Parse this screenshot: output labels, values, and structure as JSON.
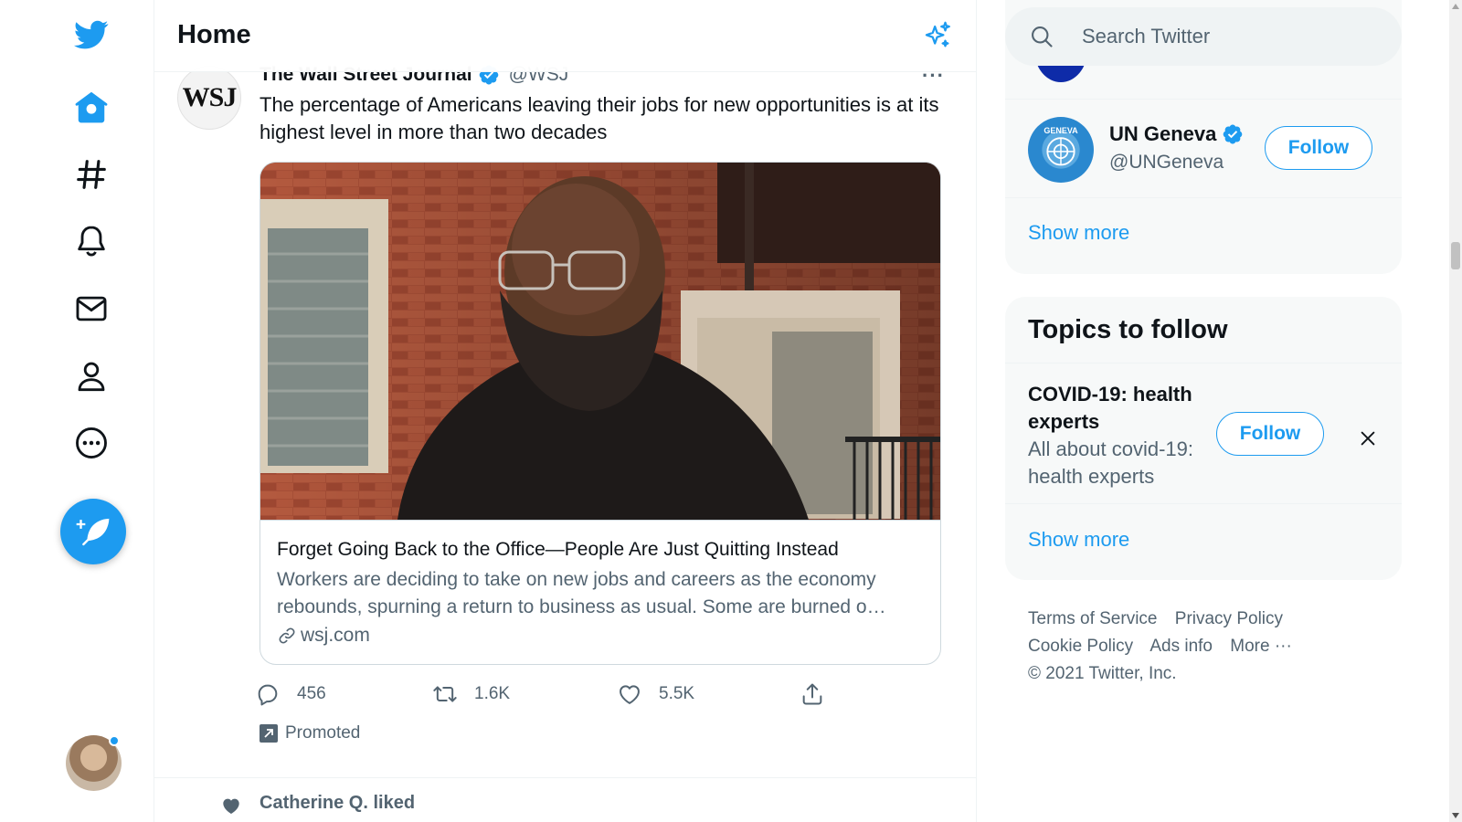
{
  "header": {
    "title": "Home"
  },
  "nav": {
    "items": [
      {
        "name": "twitter-logo",
        "icon": "twitter-bird-icon"
      },
      {
        "name": "home",
        "icon": "home-icon"
      },
      {
        "name": "explore",
        "icon": "hashtag-icon"
      },
      {
        "name": "notifications",
        "icon": "bell-icon"
      },
      {
        "name": "messages",
        "icon": "mail-icon"
      },
      {
        "name": "profile",
        "icon": "person-icon"
      },
      {
        "name": "more",
        "icon": "more-circle-icon"
      }
    ],
    "compose_icon": "compose-feather-icon",
    "has_notification_dot": true
  },
  "tweet": {
    "author_name": "The Wall Street Journal",
    "author_handle": "@WSJ",
    "verified": true,
    "avatar_text": "WSJ",
    "more": "···",
    "text": "The percentage of Americans leaving their jobs for new opportunities is at its highest level in more than two decades",
    "card": {
      "title": "Forget Going Back to the Office—People Are Just Quitting Instead",
      "description": "Workers are deciding to take on new jobs and careers as the economy rebounds, spurning a return to business as usual. Some are burned o…",
      "domain": "wsj.com"
    },
    "actions": {
      "replies": "456",
      "retweets": "1.6K",
      "likes": "5.5K"
    },
    "promoted_label": "Promoted"
  },
  "next_item": {
    "liked_by": "Catherine Q. liked"
  },
  "search": {
    "placeholder": "Search Twitter"
  },
  "who_to_follow": {
    "items": [
      {
        "name": "UN Geneva",
        "handle": "@UNGeneva",
        "verified": true,
        "avatar_text": "GENEVA",
        "button": "Follow"
      }
    ],
    "show_more": "Show more"
  },
  "topics": {
    "title": "Topics to follow",
    "items": [
      {
        "name": "COVID-19: health experts",
        "description": "All about covid-19: health experts",
        "button": "Follow"
      }
    ],
    "show_more": "Show more"
  },
  "footer": {
    "links": [
      "Terms of Service",
      "Privacy Policy",
      "Cookie Policy",
      "Ads info",
      "More ···"
    ],
    "copyright": "© 2021 Twitter, Inc."
  },
  "colors": {
    "accent": "#1d9bf0",
    "text": "#0f1419",
    "secondary": "#536471",
    "panel_bg": "#f7f9f9"
  }
}
